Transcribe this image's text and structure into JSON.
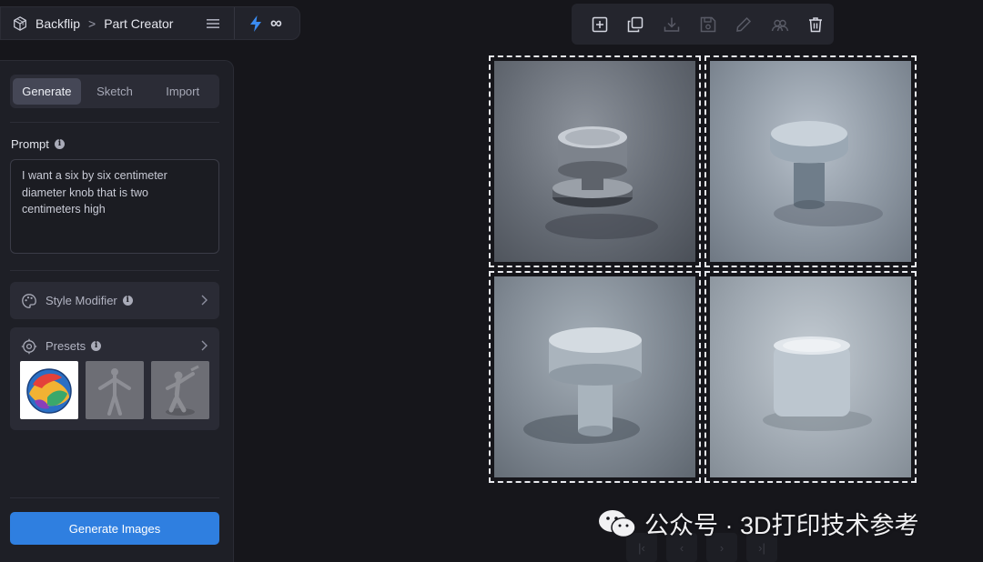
{
  "header": {
    "brand": "Backflip",
    "separator": ">",
    "page": "Part Creator",
    "credits": "∞"
  },
  "tabs": [
    {
      "label": "Generate",
      "active": true
    },
    {
      "label": "Sketch",
      "active": false
    },
    {
      "label": "Import",
      "active": false
    }
  ],
  "prompt": {
    "label": "Prompt",
    "value": "I want a six by six centimeter diameter knob that is two centimeters high"
  },
  "style_modifier": {
    "label": "Style Modifier"
  },
  "presets": {
    "label": "Presets"
  },
  "generate_button": {
    "label": "Generate Images"
  },
  "toolbar": {
    "icons": [
      "add-icon",
      "duplicate-icon",
      "download-icon",
      "save-icon",
      "edit-icon",
      "compare-icon",
      "delete-icon"
    ]
  },
  "watermark": {
    "text": "公众号 · 3D打印技术参考"
  },
  "colors": {
    "accent": "#2f7fe0",
    "bolt": "#3b8cf2",
    "panel": "#1e1f26",
    "background": "#16161b"
  }
}
